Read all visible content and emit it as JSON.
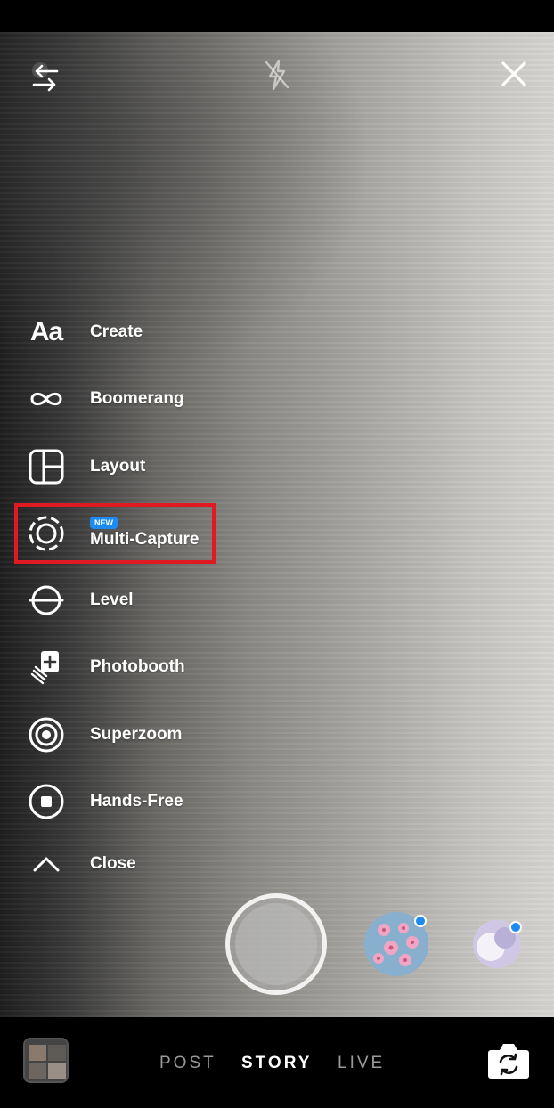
{
  "top_bar": {
    "switch_icon": "arrows-swap-icon",
    "flash_icon": "flash-off-icon",
    "close_icon": "close-icon"
  },
  "menu": {
    "items": [
      {
        "label": "Create",
        "icon": "text-aa-icon",
        "icon_text": "Aa"
      },
      {
        "label": "Boomerang",
        "icon": "infinity-icon"
      },
      {
        "label": "Layout",
        "icon": "layout-grid-icon"
      },
      {
        "label": "Multi-Capture",
        "icon": "dashed-circle-icon",
        "badge": "NEW"
      },
      {
        "label": "Level",
        "icon": "level-icon"
      },
      {
        "label": "Photobooth",
        "icon": "photobooth-stack-icon"
      },
      {
        "label": "Superzoom",
        "icon": "superzoom-icon"
      },
      {
        "label": "Hands-Free",
        "icon": "hands-free-icon"
      },
      {
        "label": "Close",
        "icon": "chevron-up-icon"
      }
    ]
  },
  "capture": {
    "shutter_icon": "shutter-button"
  },
  "bottom_bar": {
    "tabs": [
      "POST",
      "STORY",
      "LIVE"
    ],
    "active_tab": "STORY",
    "gallery_icon": "gallery-thumbnail-icon",
    "flip_camera_icon": "flip-camera-icon"
  },
  "colors": {
    "highlight": "#e01a22",
    "badge": "#1d8bf1",
    "inactive_tab": "#9a9a9a"
  }
}
